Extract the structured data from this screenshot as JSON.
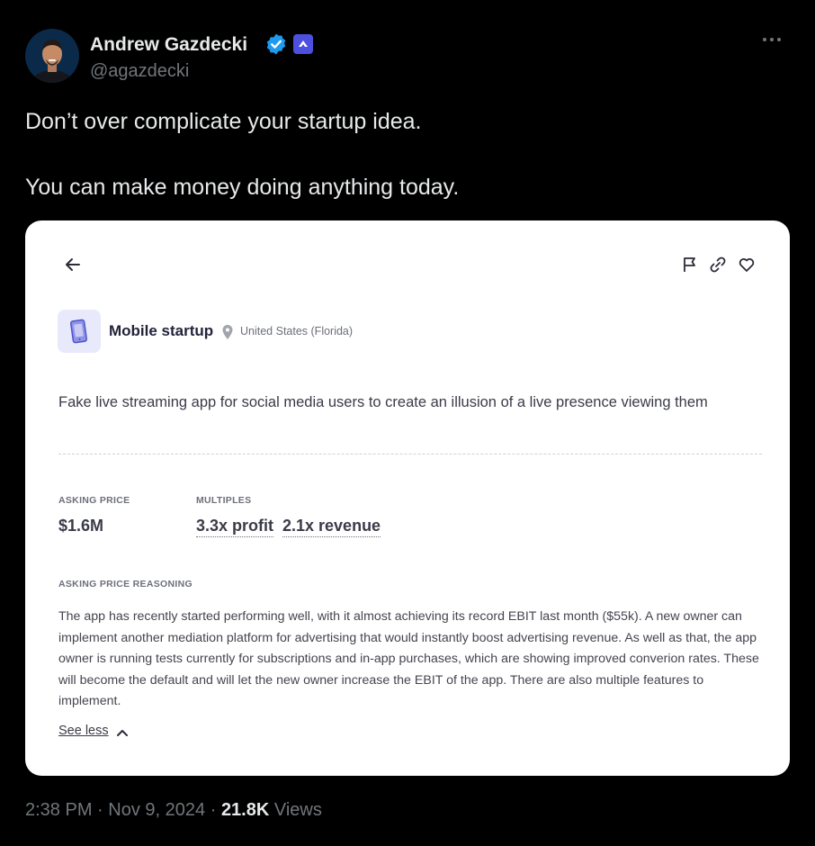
{
  "author": {
    "display_name": "Andrew Gazdecki",
    "handle": "@agazdecki",
    "avatar_icon": "profile-photo",
    "verified_icon": "verified-badge-icon",
    "affiliate_icon": "affiliate-badge-icon"
  },
  "tweet": {
    "line1": "Don’t over complicate your startup idea.",
    "line2": "You can make money doing anything today."
  },
  "card": {
    "category": "Mobile startup",
    "location": "United States (Florida)",
    "description": "Fake live streaming app for social media users to create an illusion of a live presence viewing them",
    "asking_price_label": "ASKING PRICE",
    "asking_price": "$1.6M",
    "multiples_label": "MULTIPLES",
    "multiple_profit": "3.3x profit",
    "multiple_revenue": "2.1x revenue",
    "reasoning_label": "ASKING PRICE REASONING",
    "reasoning": "The app has recently started performing well, with it almost achieving its record EBIT last month ($55k). A new owner can implement another mediation platform for advertising that would instantly boost advertising revenue. As well as that, the app owner is running tests currently for subscriptions and in-app purchases, which are showing improved converion rates. These will become the default and will let the new owner increase the EBIT of the app. There are also multiple features to implement.",
    "see_less": "See less"
  },
  "meta": {
    "time": "2:38 PM",
    "date": "Nov 9, 2024",
    "views_count": "21.8K",
    "views_label": "Views"
  },
  "colors": {
    "background": "#000000",
    "text_primary": "#e7e9ea",
    "text_secondary": "#71767b",
    "verified_blue": "#1d9bf0",
    "affiliate_purple": "#4d4fde",
    "card_bg": "#ffffff"
  }
}
